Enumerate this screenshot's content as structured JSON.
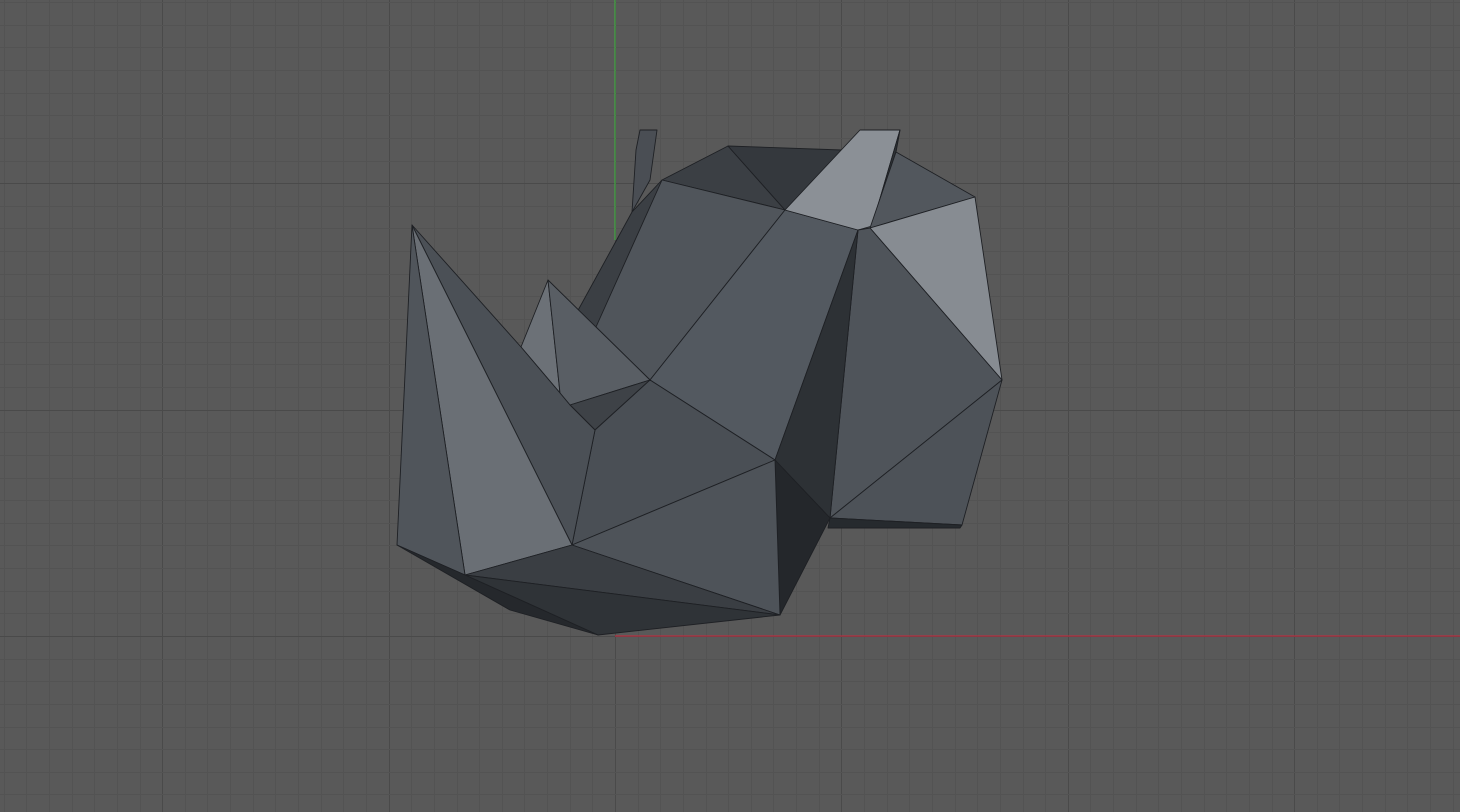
{
  "viewport": {
    "view_type": "orthographic-3d-viewport",
    "background_color": "#595959",
    "grid_minor_color": "#535353",
    "grid_major_color": "#4a4a4a",
    "x_axis_color": "#d0263c",
    "y_axis_color": "#3fb83f"
  },
  "model": {
    "object": "low-poly-rhino-head",
    "mesh_shading": "flat",
    "wire_color": "#1e2024"
  }
}
